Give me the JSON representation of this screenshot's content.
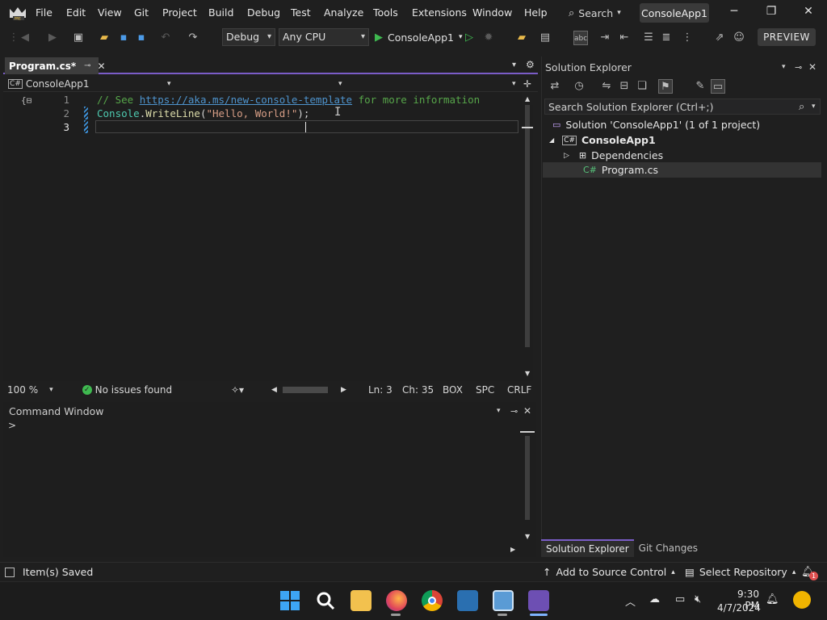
{
  "menu": {
    "items": [
      "File",
      "Edit",
      "View",
      "Git",
      "Project",
      "Build",
      "Debug",
      "Test",
      "Analyze",
      "Tools",
      "Extensions",
      "Window",
      "Help"
    ],
    "search_label": "Search",
    "solution_badge": "ConsoleApp1"
  },
  "toolbar": {
    "config": "Debug",
    "platform": "Any CPU",
    "run_target": "ConsoleApp1",
    "preview_label": "PREVIEW"
  },
  "editor": {
    "tab_label": "Program.cs*",
    "nav_project": "ConsoleApp1",
    "lines": [
      {
        "num": "1"
      },
      {
        "num": "2"
      },
      {
        "num": "3"
      }
    ],
    "code": {
      "comment_prefix": "// See ",
      "comment_link": "https://aka.ms/new-console-template",
      "comment_suffix": " for more information",
      "cls": "Console",
      "dot": ".",
      "method": "WriteLine",
      "open": "(",
      "string": "\"Hello, World!\"",
      "close": ");"
    },
    "status": {
      "zoom": "100 %",
      "issues": "No issues found",
      "line": "Ln: 3",
      "col": "Ch: 35",
      "mode": "BOX",
      "whitespace": "SPC",
      "eol": "CRLF"
    }
  },
  "command_window": {
    "title": "Command Window",
    "prompt": ">"
  },
  "solution_explorer": {
    "title": "Solution Explorer",
    "search_placeholder": "Search Solution Explorer (Ctrl+;)",
    "solution": "Solution 'ConsoleApp1' (1 of 1 project)",
    "project": "ConsoleApp1",
    "dependencies": "Dependencies",
    "file": "Program.cs",
    "tabs": [
      "Solution Explorer",
      "Git Changes"
    ]
  },
  "statusbar": {
    "message": "Item(s) Saved",
    "source_control": "Add to Source Control",
    "repository": "Select Repository"
  },
  "taskbar": {
    "time": "9:30 PM",
    "date": "4/7/2024",
    "notification_count": "1"
  },
  "colors": {
    "accent": "#7a5cc7",
    "run_green": "#3fb950",
    "link_blue": "#4e94ce"
  }
}
